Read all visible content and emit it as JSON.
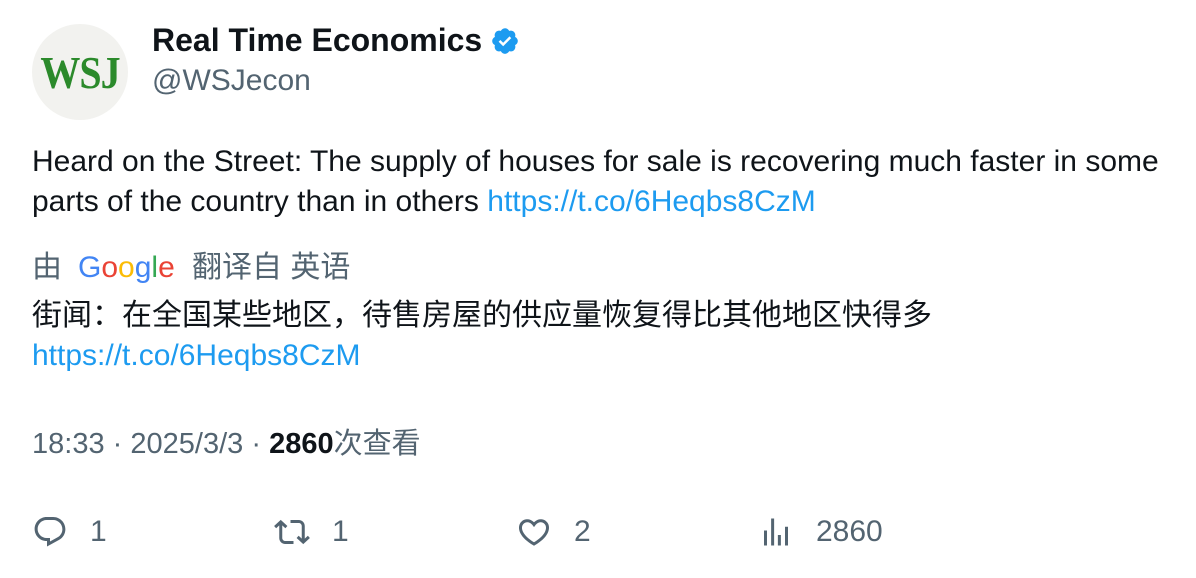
{
  "author": {
    "avatar_text": "WSJ",
    "display_name": "Real Time Economics",
    "handle": "@WSJecon",
    "verified_icon": "verified-badge-icon"
  },
  "tweet": {
    "text_main": "Heard on the Street: The supply of houses for sale is recovering much faster in some parts of the country than in others",
    "link": "https://t.co/6Heqbs8CzM"
  },
  "translation": {
    "by_label": "由",
    "provider": "Google",
    "from_label": "翻译自 英语",
    "text_main": "街闻：在全国某些地区，待售房屋的供应量恢复得比其他地区快得多",
    "link": "https://t.co/6Heqbs8CzM"
  },
  "meta": {
    "time": "18:33",
    "separator": "·",
    "date": "2025/3/3",
    "views_count": "2860",
    "views_label": "次查看"
  },
  "actions": {
    "reply": {
      "icon": "reply-icon",
      "count": "1"
    },
    "retweet": {
      "icon": "retweet-icon",
      "count": "1"
    },
    "like": {
      "icon": "heart-icon",
      "count": "2"
    },
    "views": {
      "icon": "analytics-icon",
      "count": "2860"
    }
  },
  "colors": {
    "link": "#1d9bf0",
    "secondary_text": "#536471",
    "primary_text": "#0f1419",
    "avatar_logo": "#2b8a2b"
  }
}
